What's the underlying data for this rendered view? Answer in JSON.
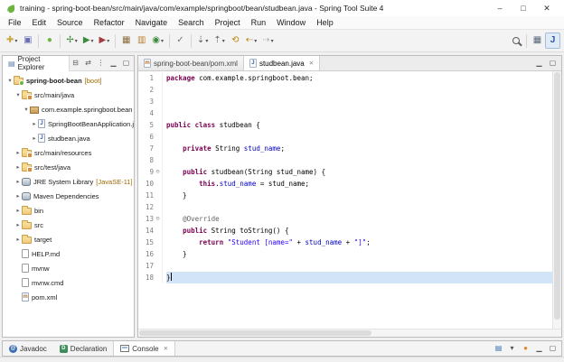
{
  "window": {
    "title": "training - spring-boot-bean/src/main/java/com/example/springboot/bean/studbean.java - Spring Tool Suite 4",
    "controls": {
      "minimize": "–",
      "maximize": "□",
      "close": "✕"
    }
  },
  "menu": {
    "items": [
      "File",
      "Edit",
      "Source",
      "Refactor",
      "Navigate",
      "Search",
      "Project",
      "Run",
      "Window",
      "Help"
    ]
  },
  "toolbar": {
    "groups": [
      [
        {
          "name": "new-wizard",
          "glyph": "✚",
          "color": "#caa53f",
          "dropdown": true
        },
        {
          "name": "save",
          "glyph": "▣",
          "color": "#6a6fb5"
        }
      ],
      [
        {
          "name": "boot-dashboard",
          "glyph": "●",
          "color": "#6db33f"
        }
      ],
      [
        {
          "name": "debug",
          "glyph": "✢",
          "color": "#3c8a3c",
          "dropdown": true
        },
        {
          "name": "run",
          "glyph": "▶",
          "color": "#3c8a3c",
          "dropdown": true
        },
        {
          "name": "coverage",
          "glyph": "▶",
          "color": "#a33c3c",
          "dropdown": true
        }
      ],
      [
        {
          "name": "new-java-project",
          "glyph": "▦",
          "color": "#8a6d3b"
        },
        {
          "name": "new-package",
          "glyph": "▥",
          "color": "#bb7f2e"
        },
        {
          "name": "new-class",
          "glyph": "◉",
          "color": "#3c8a3c",
          "dropdown": true
        }
      ],
      [
        {
          "name": "open-task",
          "glyph": "✓",
          "color": "#777777"
        }
      ],
      [
        {
          "name": "next-annotation",
          "glyph": "⇣",
          "color": "#666666",
          "dropdown": true
        },
        {
          "name": "previous-annotation",
          "glyph": "⇡",
          "color": "#666666",
          "dropdown": true
        },
        {
          "name": "last-edit-location",
          "glyph": "⟲",
          "color": "#b8860b"
        },
        {
          "name": "back",
          "glyph": "⇠",
          "color": "#b8860b",
          "dropdown": true
        },
        {
          "name": "forward",
          "glyph": "⇢",
          "color": "#b0b0b0",
          "dropdown": true
        }
      ]
    ],
    "right": [
      {
        "name": "search",
        "css": "mag"
      },
      {
        "sep": true
      },
      {
        "name": "open-perspective",
        "glyph": "▦",
        "color": "#556677"
      },
      {
        "name": "java-perspective",
        "glyph": "J",
        "color": "#2c56a0",
        "bold": true,
        "active": true
      }
    ]
  },
  "explorer": {
    "title": "Project Explorer",
    "icon": "▤",
    "tools": [
      {
        "name": "collapse-all",
        "glyph": "⊟"
      },
      {
        "name": "link-with-editor",
        "glyph": "⇄"
      },
      {
        "name": "view-menu",
        "glyph": "⋮"
      },
      {
        "name": "minimize-view",
        "glyph": "▁"
      },
      {
        "name": "maximize-view",
        "glyph": "▢"
      }
    ],
    "items": [
      {
        "label": "spring-boot-bean",
        "decorator": "[boot]",
        "level": 0,
        "expand": "open",
        "icon": "project",
        "bold": true
      },
      {
        "label": "src/main/java",
        "level": 1,
        "expand": "open",
        "icon": "srcfolder"
      },
      {
        "label": "com.example.springboot.bean",
        "level": 2,
        "expand": "open",
        "icon": "package"
      },
      {
        "label": "SpringBootBeanApplication.java",
        "level": 3,
        "expand": "closed",
        "icon": "java",
        "icon_text": "J"
      },
      {
        "label": "studbean.java",
        "level": 3,
        "expand": "closed",
        "icon": "java",
        "icon_text": "J"
      },
      {
        "label": "src/main/resources",
        "level": 1,
        "expand": "closed",
        "icon": "srcfolder"
      },
      {
        "label": "src/test/java",
        "level": 1,
        "expand": "closed",
        "icon": "srcfolder"
      },
      {
        "label": "JRE System Library",
        "decorator": "[JavaSE-11]",
        "level": 1,
        "expand": "closed",
        "icon": "lib"
      },
      {
        "label": "Maven Dependencies",
        "level": 1,
        "expand": "closed",
        "icon": "lib"
      },
      {
        "label": "bin",
        "level": 1,
        "expand": "closed",
        "icon": "folder"
      },
      {
        "label": "src",
        "level": 1,
        "expand": "closed",
        "icon": "folder"
      },
      {
        "label": "target",
        "level": 1,
        "expand": "closed",
        "icon": "folder"
      },
      {
        "label": "HELP.md",
        "level": 1,
        "icon": "file"
      },
      {
        "label": "mvnw",
        "level": 1,
        "icon": "file"
      },
      {
        "label": "mvnw.cmd",
        "level": 1,
        "icon": "file"
      },
      {
        "label": "pom.xml",
        "level": 1,
        "icon": "xml",
        "icon_text": "m"
      }
    ]
  },
  "editor": {
    "tabs": [
      {
        "label": "spring-boot-bean/pom.xml",
        "icon_text": "m",
        "icon_color": "#b06f28"
      },
      {
        "label": "studbean.java",
        "icon_text": "J",
        "icon_color": "#2c56a0",
        "active": true,
        "closable": true
      }
    ],
    "tools": [
      {
        "name": "minimize-editor",
        "glyph": "▁"
      },
      {
        "name": "maximize-editor",
        "glyph": "▢"
      }
    ],
    "lines": [
      {
        "n": 1,
        "tokens": [
          [
            "k",
            "package"
          ],
          [
            "p",
            " com.example.springboot.bean;"
          ]
        ]
      },
      {
        "n": 2,
        "tokens": []
      },
      {
        "n": 3,
        "tokens": []
      },
      {
        "n": 4,
        "tokens": []
      },
      {
        "n": 5,
        "tokens": [
          [
            "k",
            "public"
          ],
          [
            "p",
            " "
          ],
          [
            "k",
            "class"
          ],
          [
            "p",
            " studbean {"
          ]
        ]
      },
      {
        "n": 6,
        "tokens": []
      },
      {
        "n": 7,
        "tokens": [
          [
            "p",
            "    "
          ],
          [
            "k",
            "private"
          ],
          [
            "p",
            " String "
          ],
          [
            "f",
            "stud_name"
          ],
          [
            "p",
            ";"
          ]
        ]
      },
      {
        "n": 8,
        "tokens": []
      },
      {
        "n": 9,
        "fold": true,
        "tokens": [
          [
            "p",
            "    "
          ],
          [
            "k",
            "public"
          ],
          [
            "p",
            " studbean(String stud_name) {"
          ]
        ]
      },
      {
        "n": 10,
        "tokens": [
          [
            "p",
            "        "
          ],
          [
            "k",
            "this"
          ],
          [
            "p",
            "."
          ],
          [
            "f",
            "stud_name"
          ],
          [
            "p",
            " = stud_name;"
          ]
        ]
      },
      {
        "n": 11,
        "tokens": [
          [
            "p",
            "    }"
          ]
        ]
      },
      {
        "n": 12,
        "tokens": []
      },
      {
        "n": 13,
        "fold": true,
        "tokens": [
          [
            "p",
            "    "
          ],
          [
            "a",
            "@Override"
          ]
        ]
      },
      {
        "n": 14,
        "tokens": [
          [
            "p",
            "    "
          ],
          [
            "k",
            "public"
          ],
          [
            "p",
            " String toString() {"
          ]
        ]
      },
      {
        "n": 15,
        "tokens": [
          [
            "p",
            "        "
          ],
          [
            "k",
            "return"
          ],
          [
            "p",
            " "
          ],
          [
            "s",
            "\"Student [name=\""
          ],
          [
            "p",
            " + "
          ],
          [
            "f",
            "stud_name"
          ],
          [
            "p",
            " + "
          ],
          [
            "s",
            "\"]\""
          ],
          [
            "p",
            ";"
          ]
        ]
      },
      {
        "n": 16,
        "tokens": [
          [
            "p",
            "    }"
          ]
        ]
      },
      {
        "n": 17,
        "tokens": []
      },
      {
        "n": 18,
        "current": true,
        "caret": true,
        "tokens": [
          [
            "p",
            "}"
          ]
        ]
      }
    ]
  },
  "bottom": {
    "tabs": [
      {
        "label": "Javadoc",
        "icon": "javadoc",
        "icon_text": "@"
      },
      {
        "label": "Declaration",
        "icon": "declaration",
        "icon_text": "D"
      },
      {
        "label": "Console",
        "icon": "console",
        "icon_text": "",
        "active": true,
        "closable": true
      }
    ],
    "tools": [
      {
        "name": "open-console",
        "glyph": "▤",
        "color": "#3b6fb6"
      },
      {
        "name": "console-menu",
        "glyph": "▾",
        "color": "#555555"
      },
      {
        "name": "notification",
        "glyph": "●",
        "color": "#e8862a"
      },
      {
        "name": "minimize-panel",
        "glyph": "▁",
        "color": "#555555"
      },
      {
        "name": "maximize-panel",
        "glyph": "▢",
        "color": "#555555"
      }
    ]
  },
  "colors": {
    "keyword": "#7b0052",
    "string": "#2a00ff",
    "field": "#0000c0",
    "annotation": "#646464",
    "current_line": "#d2e4f7",
    "spring_green": "#6db33f"
  }
}
